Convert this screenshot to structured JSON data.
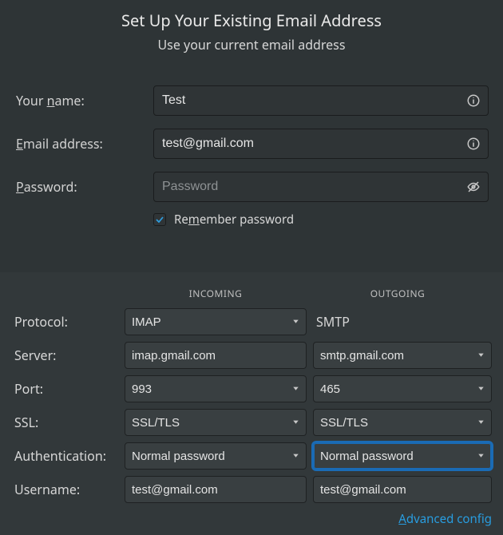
{
  "header": {
    "title": "Set Up Your Existing Email Address",
    "subtitle": "Use your current email address"
  },
  "labels": {
    "name_pre": "Your ",
    "name_u": "n",
    "name_post": "ame:",
    "email_u": "E",
    "email_post": "mail address:",
    "pass_u": "P",
    "pass_post": "assword:",
    "remember_pre": "Re",
    "remember_u": "m",
    "remember_post": "ember password"
  },
  "values": {
    "name": "Test",
    "email": "test@gmail.com",
    "password": "",
    "password_placeholder": "Password",
    "remember": true
  },
  "col_headers": {
    "incoming": "INCOMING",
    "outgoing": "OUTGOING"
  },
  "cfg_labels": {
    "protocol": "Protocol:",
    "server": "Server:",
    "port": "Port:",
    "ssl": "SSL:",
    "auth": "Authentication:",
    "username": "Username:"
  },
  "incoming": {
    "protocol": "IMAP",
    "server": "imap.gmail.com",
    "port": "993",
    "ssl": "SSL/TLS",
    "auth": "Normal password",
    "username": "test@gmail.com"
  },
  "outgoing": {
    "protocol": "SMTP",
    "server": "smtp.gmail.com",
    "port": "465",
    "ssl": "SSL/TLS",
    "auth": "Normal password",
    "username": "test@gmail.com"
  },
  "footer": {
    "advanced_u": "A",
    "advanced_post": "dvanced config"
  }
}
